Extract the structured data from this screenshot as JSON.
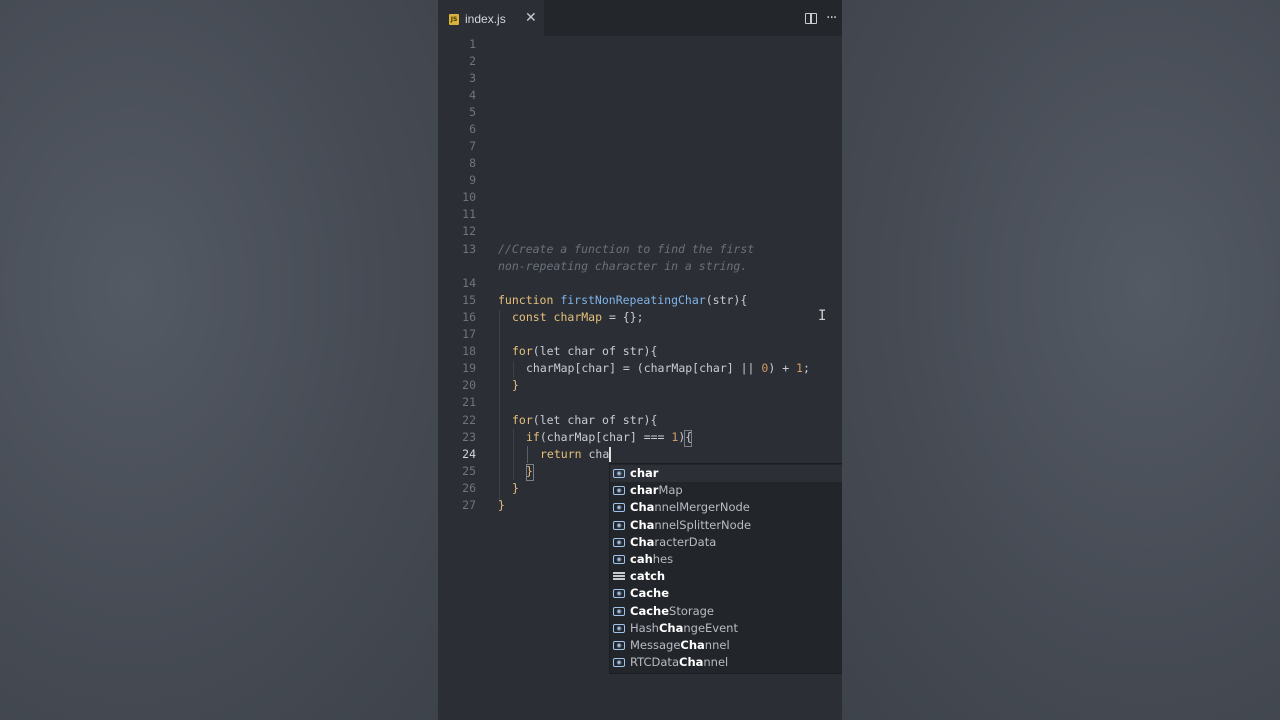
{
  "tab": {
    "icon": "js-file-icon",
    "icon_text": "JS",
    "label": "index.js",
    "close": "✕"
  },
  "toolbar": {
    "split_icon": "split-editor-icon",
    "more": "···"
  },
  "lines": [
    {
      "n": "1"
    },
    {
      "n": "2"
    },
    {
      "n": "3"
    },
    {
      "n": "4"
    },
    {
      "n": "5"
    },
    {
      "n": "6"
    },
    {
      "n": "7"
    },
    {
      "n": "8"
    },
    {
      "n": "9"
    },
    {
      "n": "10"
    },
    {
      "n": "11"
    },
    {
      "n": "12"
    },
    {
      "n": "13"
    },
    {
      "n": "14"
    },
    {
      "n": "15"
    },
    {
      "n": "16"
    },
    {
      "n": "17"
    },
    {
      "n": "18"
    },
    {
      "n": "19"
    },
    {
      "n": "20"
    },
    {
      "n": "21"
    },
    {
      "n": "22"
    },
    {
      "n": "23"
    },
    {
      "n": "24"
    },
    {
      "n": "25"
    },
    {
      "n": "26"
    },
    {
      "n": "27"
    }
  ],
  "code": {
    "l13a": "//Create a function to find the first",
    "l13b": "non-repeating character in a string.",
    "l15_kw": "function ",
    "l15_fn": "firstNonRepeatingChar",
    "l15_rest": "(str){",
    "l16_kw": "const ",
    "l16_var": "charMap",
    "l16_rest": " = {};",
    "l18_kw": "for",
    "l18_rest": "(let char of str){",
    "l19_a": "charMap[char] = (charMap[char] || ",
    "l19_num": "0",
    "l19_b": ") + ",
    "l19_num2": "1",
    "l19_c": ";",
    "l20": "}",
    "l22_kw": "for",
    "l22_rest": "(let char of str){",
    "l23_kw": "if",
    "l23_a": "(charMap[char] === ",
    "l23_num": "1",
    "l23_b": "){",
    "l24_kw": "return ",
    "l24_rest": "cha",
    "l25": "}",
    "l26": "}",
    "l27": "}"
  },
  "suggestions": [
    {
      "bold": "char",
      "rest": "",
      "pre": "",
      "icon": "variable-icon"
    },
    {
      "bold": "char",
      "rest": "Map",
      "pre": "",
      "icon": "variable-icon"
    },
    {
      "bold": "Cha",
      "rest": "nnelMergerNode",
      "pre": "",
      "icon": "variable-icon"
    },
    {
      "bold": "Cha",
      "rest": "nnelSplitterNode",
      "pre": "",
      "icon": "variable-icon"
    },
    {
      "bold": "Cha",
      "rest": "racterData",
      "pre": "",
      "icon": "variable-icon"
    },
    {
      "bold": "ca",
      "rest": "ches",
      "pre": "",
      "icon": "variable-icon",
      "mid": "h"
    },
    {
      "bold": "catch",
      "rest": "",
      "pre": "",
      "icon": "keyword-icon"
    },
    {
      "bold": "Cache",
      "rest": "",
      "pre": "",
      "icon": "variable-icon"
    },
    {
      "bold": "Cache",
      "rest": "Storage",
      "pre": "",
      "icon": "variable-icon"
    },
    {
      "bold": "Cha",
      "rest": "ngeEvent",
      "pre": "Hash",
      "icon": "variable-icon"
    },
    {
      "bold": "Cha",
      "rest": "nnel",
      "pre": "Message",
      "icon": "variable-icon"
    },
    {
      "bold": "Cha",
      "rest": "nnel",
      "pre": "RTCData",
      "icon": "variable-icon"
    }
  ]
}
